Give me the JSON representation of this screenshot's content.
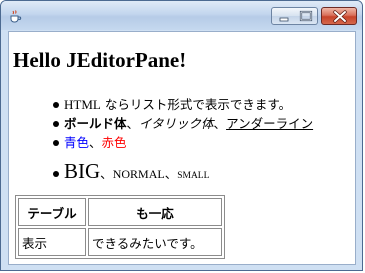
{
  "window": {
    "title": ""
  },
  "document": {
    "heading": "Hello JEditorPane!",
    "list": [
      {
        "part1": "HTML",
        "part2": " ならリスト形式で表示できます。"
      },
      {
        "bold": "ボールド体",
        "sep1": "、",
        "italic": "イタリック体",
        "sep2": "、",
        "underline": "アンダーライン"
      },
      {
        "blue": "青色",
        "sep": "、",
        "red": "赤色"
      },
      {
        "big": "BIG",
        "sep1": "、",
        "normal": "NORMAL",
        "sep2": "、",
        "small": "SMALL"
      }
    ],
    "table": {
      "headers": [
        "テーブル",
        "も一応"
      ],
      "row": [
        "表示",
        "できるみたいです。"
      ]
    }
  },
  "colors": {
    "blue": "#0000ff",
    "red": "#ff0000",
    "titlebar": "#c3d6ee",
    "close_button": "#c7432a"
  },
  "icons": {
    "app": "java-cup-icon",
    "minimize": "minimize-icon",
    "maximize": "maximize-icon",
    "close": "close-icon"
  }
}
